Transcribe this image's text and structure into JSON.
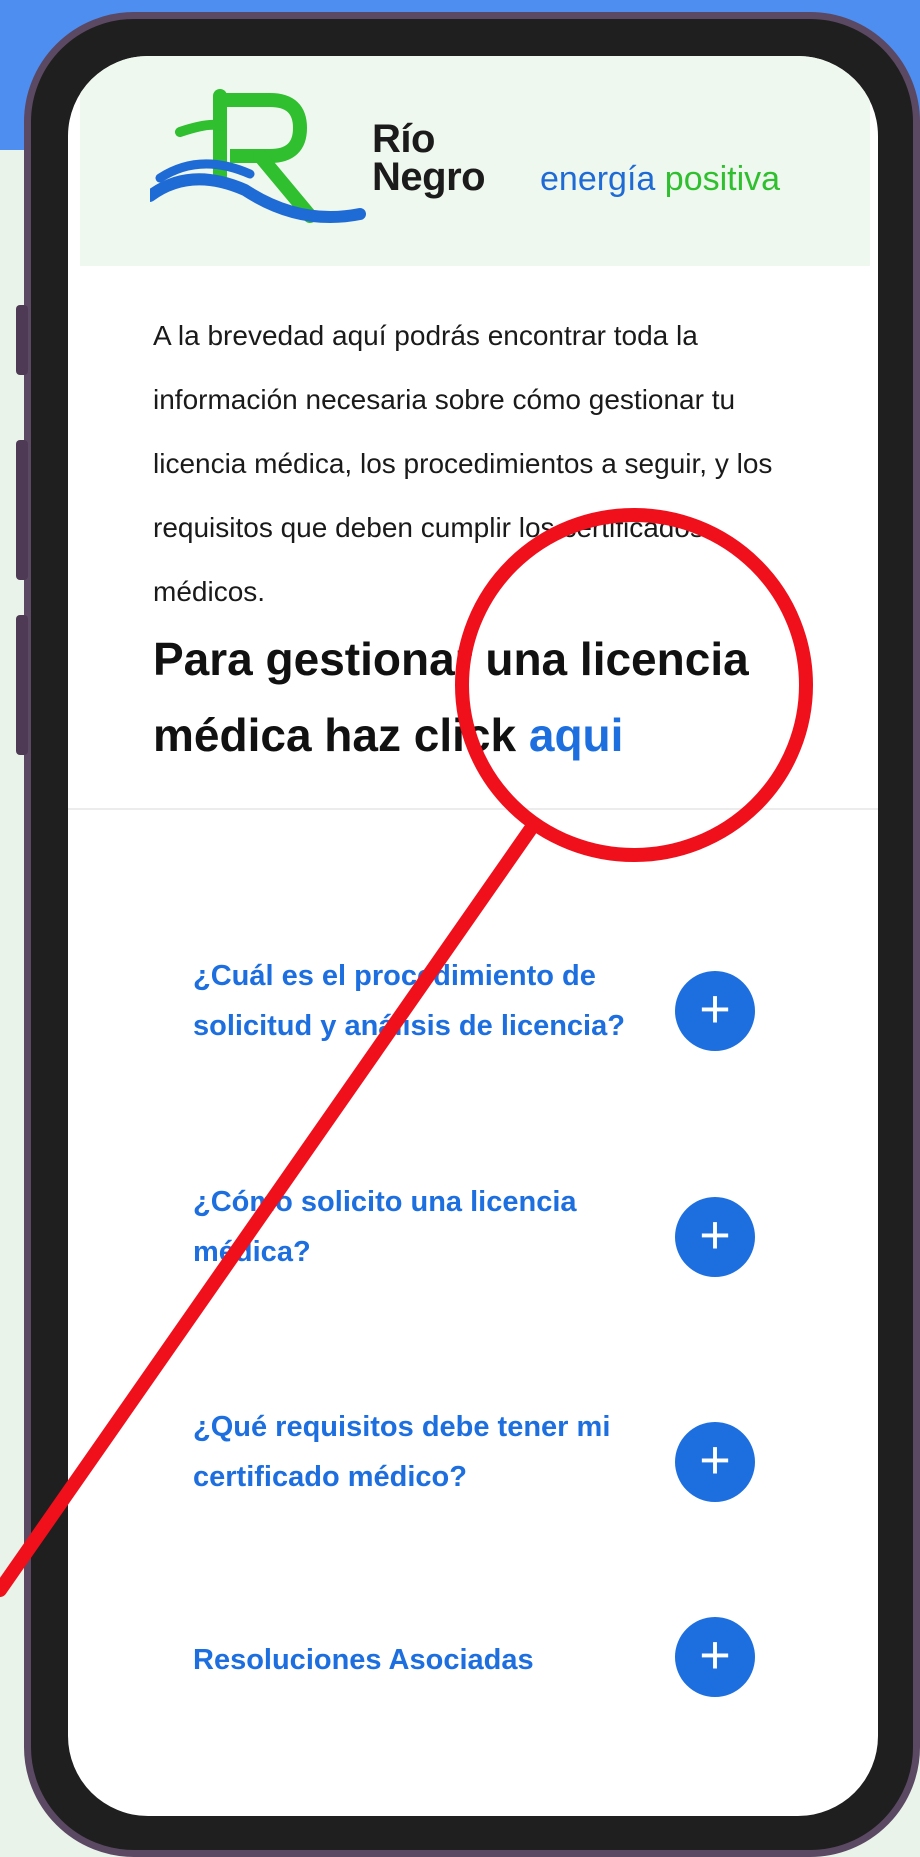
{
  "brand": {
    "name_line1": "Río",
    "name_line2": "Negro",
    "tagline_part1": "energía",
    "tagline_part2": "positiva",
    "colors": {
      "green": "#2fbf2f",
      "blue": "#1f6bd6"
    }
  },
  "intro_text": "A la brevedad aquí podrás encontrar toda la información necesaria sobre cómo gestionar tu licencia médica, los procedimientos a seguir, y los requisitos que deben cumplir los certificados médicos.",
  "cta": {
    "text": "Para gestionar una licencia médica haz click",
    "link_label": "aqui"
  },
  "faq": [
    {
      "label": "¿Cuál es el procedimiento de solicitud y análisis de licencia?",
      "button_icon": "plus-icon"
    },
    {
      "label": "¿Cómo solicito una licencia médica?",
      "button_icon": "plus-icon"
    },
    {
      "label": "¿Qué requisitos debe tener mi certificado médico?",
      "button_icon": "plus-icon"
    },
    {
      "label": "Resoluciones Asociadas",
      "button_icon": "plus-icon"
    }
  ],
  "colors": {
    "accent_blue": "#1d6fe0",
    "annotation_red": "#f0101c",
    "phone_frame": "#5b4862"
  }
}
